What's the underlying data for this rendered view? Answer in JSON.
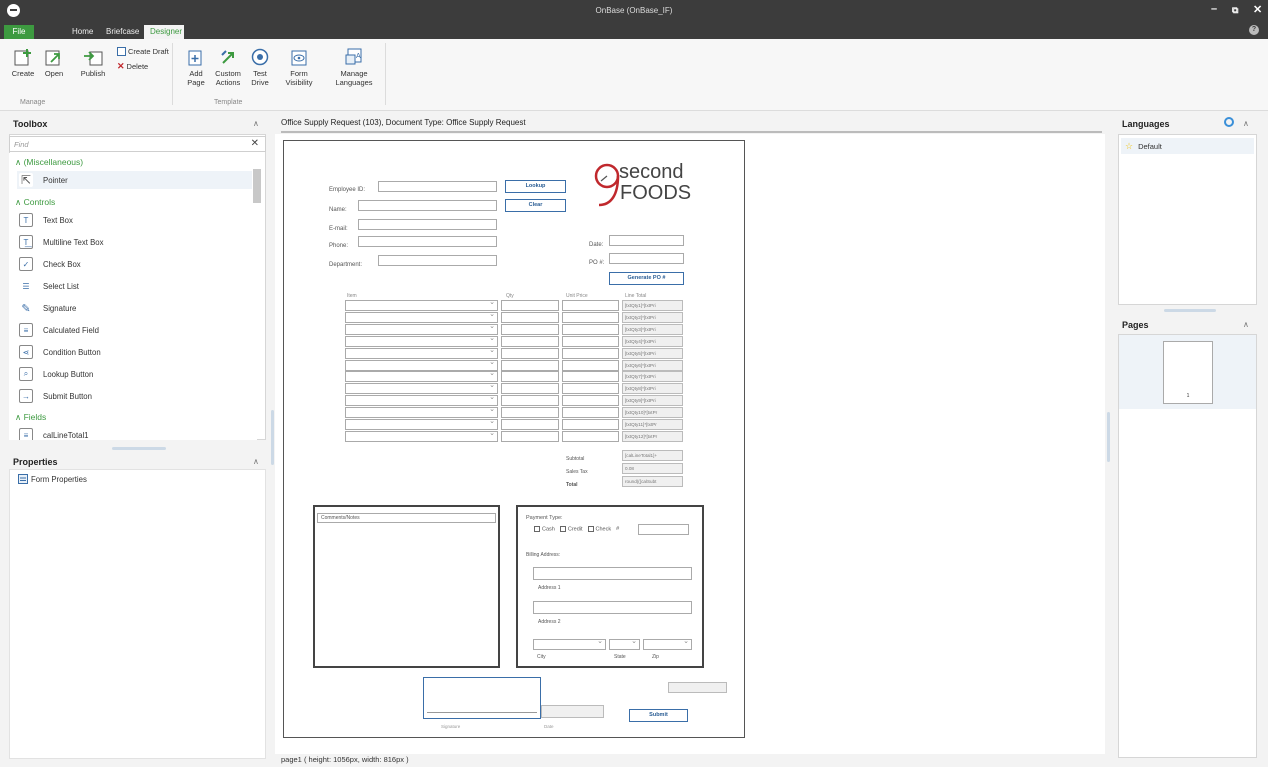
{
  "window": {
    "title": "OnBase (OnBase_IF)"
  },
  "tabs": {
    "file": "File",
    "home": "Home",
    "briefcase": "Briefcase",
    "designer": "Designer"
  },
  "ribbon": {
    "create": "Create",
    "open": "Open",
    "publish": "Publish",
    "create_draft": "Create Draft",
    "delete": "Delete",
    "add_page": "Add Page",
    "custom_actions": "Custom Actions",
    "test_drive": "Test Drive",
    "form_visibility": "Form Visibility",
    "manage_languages": "Manage Languages",
    "group_manage": "Manage",
    "group_template": "Template"
  },
  "toolbox": {
    "title": "Toolbox",
    "find_placeholder": "Find",
    "cat_misc": "(Miscellaneous)",
    "cat_controls": "Controls",
    "cat_fields": "Fields",
    "pointer": "Pointer",
    "controls": [
      "Text Box",
      "Multiline Text Box",
      "Check Box",
      "Select List",
      "Signature",
      "Calculated Field",
      "Condition Button",
      "Lookup Button",
      "Submit Button"
    ],
    "field_1": "calLineTotal1"
  },
  "properties": {
    "title": "Properties",
    "form_properties": "Form Properties"
  },
  "designer": {
    "doc_title": "Office Supply Request (103), Document Type: Office Supply Request",
    "page_info": "page1 ( height: 1056px, width: 816px )"
  },
  "form": {
    "logo_top": "second",
    "logo_bottom": "FOODS",
    "employee_id": "Employee ID:",
    "name": "Name:",
    "email": "E-mail:",
    "phone": "Phone:",
    "department": "Department:",
    "lookup": "Lookup",
    "clear": "Clear",
    "date": "Date:",
    "po": "PO #:",
    "generate_po": "Generate PO #",
    "col_item": "Item",
    "col_qty": "Qty",
    "col_unit": "Unit Price",
    "col_line": "Line Total",
    "line_totals": [
      "[txtQty1]*[txtPri",
      "[txtQty2]*[txtPri",
      "[txtQty3]*[txtPri",
      "[txtQty4]*[txtPri",
      "[txtQty5]*[txtPri",
      "[txtQty6]*[txtPri",
      "[txtQty7]*[txtPri",
      "[txtQty8]*[txtPri",
      "[txtQty9]*[txtPri",
      "[txtQty10]*[txtPr",
      "[txtQty11]*[txtPr",
      "[txtQty12]*[txtPr"
    ],
    "subtotal": "Subtotal",
    "subtotal_val": "[calLineTotal1]+",
    "sales_tax": "Sales Tax",
    "sales_tax_val": "0.08",
    "total": "Total",
    "total_val": "round(([calSubt",
    "comments": "Comments/Notes",
    "payment_type": "Payment Type:",
    "cash": "Cash",
    "credit": "Credit",
    "check": "Check",
    "check_no": "#",
    "billing_address": "Billing Address:",
    "address1": "Address 1",
    "address2": "Address 2",
    "city": "City",
    "state": "State",
    "zip": "Zip",
    "signature": "Signature",
    "date_small": "Date",
    "submit": "Submit"
  },
  "languages": {
    "title": "Languages",
    "default": "Default"
  },
  "pages": {
    "title": "Pages",
    "page_num": "1"
  },
  "colors": {
    "accent": "#3d9a40",
    "link": "#2a5d94",
    "titlebar": "#3c3c3c"
  }
}
